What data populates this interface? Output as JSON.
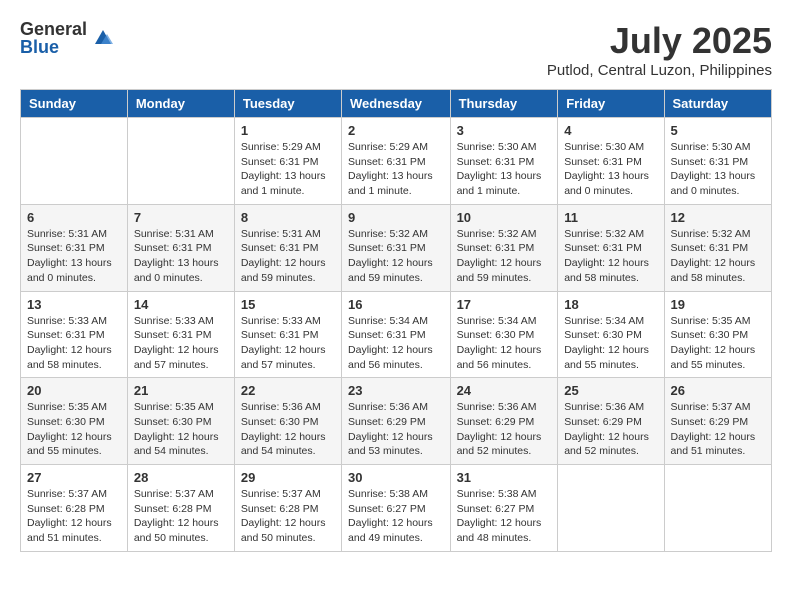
{
  "header": {
    "logo_general": "General",
    "logo_blue": "Blue",
    "month_title": "July 2025",
    "location": "Putlod, Central Luzon, Philippines"
  },
  "weekdays": [
    "Sunday",
    "Monday",
    "Tuesday",
    "Wednesday",
    "Thursday",
    "Friday",
    "Saturday"
  ],
  "weeks": [
    [
      {
        "day": "",
        "info": ""
      },
      {
        "day": "",
        "info": ""
      },
      {
        "day": "1",
        "info": "Sunrise: 5:29 AM\nSunset: 6:31 PM\nDaylight: 13 hours and 1 minute."
      },
      {
        "day": "2",
        "info": "Sunrise: 5:29 AM\nSunset: 6:31 PM\nDaylight: 13 hours and 1 minute."
      },
      {
        "day": "3",
        "info": "Sunrise: 5:30 AM\nSunset: 6:31 PM\nDaylight: 13 hours and 1 minute."
      },
      {
        "day": "4",
        "info": "Sunrise: 5:30 AM\nSunset: 6:31 PM\nDaylight: 13 hours and 0 minutes."
      },
      {
        "day": "5",
        "info": "Sunrise: 5:30 AM\nSunset: 6:31 PM\nDaylight: 13 hours and 0 minutes."
      }
    ],
    [
      {
        "day": "6",
        "info": "Sunrise: 5:31 AM\nSunset: 6:31 PM\nDaylight: 13 hours and 0 minutes."
      },
      {
        "day": "7",
        "info": "Sunrise: 5:31 AM\nSunset: 6:31 PM\nDaylight: 13 hours and 0 minutes."
      },
      {
        "day": "8",
        "info": "Sunrise: 5:31 AM\nSunset: 6:31 PM\nDaylight: 12 hours and 59 minutes."
      },
      {
        "day": "9",
        "info": "Sunrise: 5:32 AM\nSunset: 6:31 PM\nDaylight: 12 hours and 59 minutes."
      },
      {
        "day": "10",
        "info": "Sunrise: 5:32 AM\nSunset: 6:31 PM\nDaylight: 12 hours and 59 minutes."
      },
      {
        "day": "11",
        "info": "Sunrise: 5:32 AM\nSunset: 6:31 PM\nDaylight: 12 hours and 58 minutes."
      },
      {
        "day": "12",
        "info": "Sunrise: 5:32 AM\nSunset: 6:31 PM\nDaylight: 12 hours and 58 minutes."
      }
    ],
    [
      {
        "day": "13",
        "info": "Sunrise: 5:33 AM\nSunset: 6:31 PM\nDaylight: 12 hours and 58 minutes."
      },
      {
        "day": "14",
        "info": "Sunrise: 5:33 AM\nSunset: 6:31 PM\nDaylight: 12 hours and 57 minutes."
      },
      {
        "day": "15",
        "info": "Sunrise: 5:33 AM\nSunset: 6:31 PM\nDaylight: 12 hours and 57 minutes."
      },
      {
        "day": "16",
        "info": "Sunrise: 5:34 AM\nSunset: 6:31 PM\nDaylight: 12 hours and 56 minutes."
      },
      {
        "day": "17",
        "info": "Sunrise: 5:34 AM\nSunset: 6:30 PM\nDaylight: 12 hours and 56 minutes."
      },
      {
        "day": "18",
        "info": "Sunrise: 5:34 AM\nSunset: 6:30 PM\nDaylight: 12 hours and 55 minutes."
      },
      {
        "day": "19",
        "info": "Sunrise: 5:35 AM\nSunset: 6:30 PM\nDaylight: 12 hours and 55 minutes."
      }
    ],
    [
      {
        "day": "20",
        "info": "Sunrise: 5:35 AM\nSunset: 6:30 PM\nDaylight: 12 hours and 55 minutes."
      },
      {
        "day": "21",
        "info": "Sunrise: 5:35 AM\nSunset: 6:30 PM\nDaylight: 12 hours and 54 minutes."
      },
      {
        "day": "22",
        "info": "Sunrise: 5:36 AM\nSunset: 6:30 PM\nDaylight: 12 hours and 54 minutes."
      },
      {
        "day": "23",
        "info": "Sunrise: 5:36 AM\nSunset: 6:29 PM\nDaylight: 12 hours and 53 minutes."
      },
      {
        "day": "24",
        "info": "Sunrise: 5:36 AM\nSunset: 6:29 PM\nDaylight: 12 hours and 52 minutes."
      },
      {
        "day": "25",
        "info": "Sunrise: 5:36 AM\nSunset: 6:29 PM\nDaylight: 12 hours and 52 minutes."
      },
      {
        "day": "26",
        "info": "Sunrise: 5:37 AM\nSunset: 6:29 PM\nDaylight: 12 hours and 51 minutes."
      }
    ],
    [
      {
        "day": "27",
        "info": "Sunrise: 5:37 AM\nSunset: 6:28 PM\nDaylight: 12 hours and 51 minutes."
      },
      {
        "day": "28",
        "info": "Sunrise: 5:37 AM\nSunset: 6:28 PM\nDaylight: 12 hours and 50 minutes."
      },
      {
        "day": "29",
        "info": "Sunrise: 5:37 AM\nSunset: 6:28 PM\nDaylight: 12 hours and 50 minutes."
      },
      {
        "day": "30",
        "info": "Sunrise: 5:38 AM\nSunset: 6:27 PM\nDaylight: 12 hours and 49 minutes."
      },
      {
        "day": "31",
        "info": "Sunrise: 5:38 AM\nSunset: 6:27 PM\nDaylight: 12 hours and 48 minutes."
      },
      {
        "day": "",
        "info": ""
      },
      {
        "day": "",
        "info": ""
      }
    ]
  ]
}
